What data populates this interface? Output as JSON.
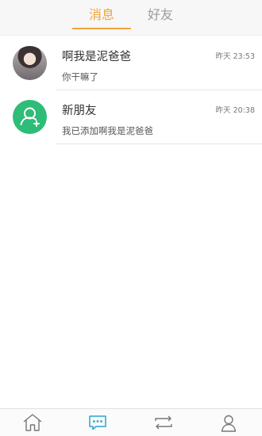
{
  "tabs": {
    "messages_label": "消息",
    "friends_label": "好友"
  },
  "conversations": [
    {
      "name": "啊我是泥爸爸",
      "time": "昨天 23:53",
      "message": "你干嘛了",
      "avatar": "user-photo"
    },
    {
      "name": "新朋友",
      "time": "昨天 20:38",
      "message": "我已添加啊我是泥爸爸",
      "avatar": "new-friend-icon"
    }
  ],
  "bottom_nav": [
    {
      "icon": "home-icon",
      "active": false
    },
    {
      "icon": "chat-icon",
      "active": true
    },
    {
      "icon": "repeat-icon",
      "active": false
    },
    {
      "icon": "user-icon",
      "active": false
    }
  ],
  "colors": {
    "accent": "#f3a53a",
    "friend_green": "#2ebd78",
    "nav_active": "#2aa6c9",
    "nav_inactive": "#777777"
  }
}
